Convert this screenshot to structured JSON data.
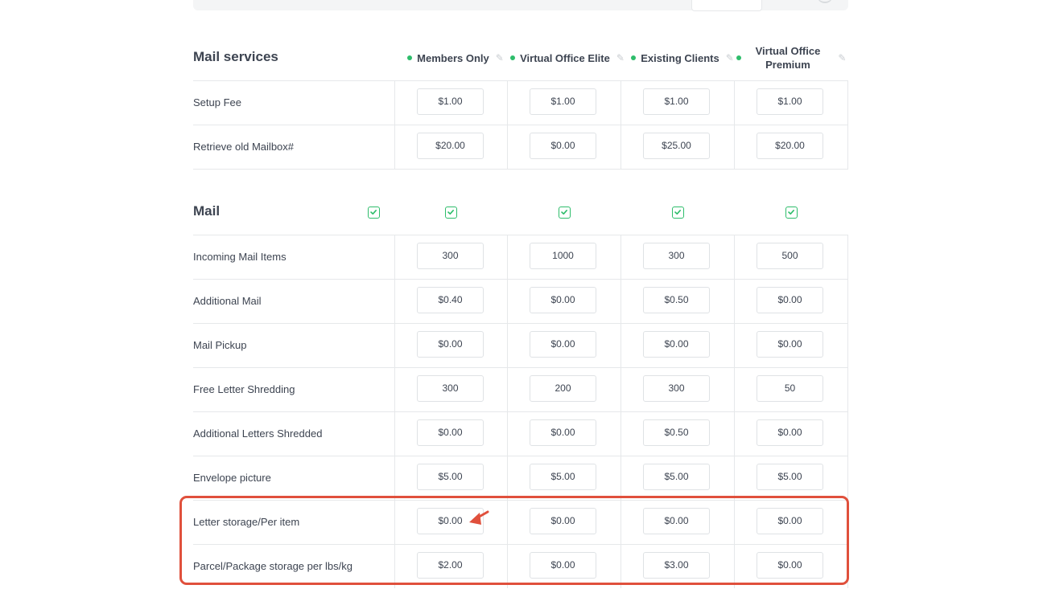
{
  "plans": [
    {
      "name": "Members Only"
    },
    {
      "name": "Virtual Office Elite"
    },
    {
      "name": "Existing Clients"
    },
    {
      "name": "Virtual Office Premium",
      "line1": "Virtual Office",
      "line2": "Premium"
    }
  ],
  "mail_services": {
    "title": "Mail services",
    "rows": [
      {
        "label": "Setup Fee",
        "values": [
          "$1.00",
          "$1.00",
          "$1.00",
          "$1.00"
        ]
      },
      {
        "label": "Retrieve old Mailbox#",
        "values": [
          "$20.00",
          "$0.00",
          "$25.00",
          "$20.00"
        ]
      }
    ]
  },
  "mail": {
    "title": "Mail",
    "rows": [
      {
        "label": "Incoming Mail Items",
        "values": [
          "300",
          "1000",
          "300",
          "500"
        ]
      },
      {
        "label": "Additional Mail",
        "values": [
          "$0.40",
          "$0.00",
          "$0.50",
          "$0.00"
        ]
      },
      {
        "label": "Mail Pickup",
        "values": [
          "$0.00",
          "$0.00",
          "$0.00",
          "$0.00"
        ]
      },
      {
        "label": "Free Letter Shredding",
        "values": [
          "300",
          "200",
          "300",
          "50"
        ]
      },
      {
        "label": "Additional Letters Shredded",
        "values": [
          "$0.00",
          "$0.00",
          "$0.50",
          "$0.00"
        ]
      },
      {
        "label": "Envelope picture",
        "values": [
          "$5.00",
          "$5.00",
          "$5.00",
          "$5.00"
        ]
      },
      {
        "label": "Letter storage/Per item",
        "values": [
          "$0.00",
          "$0.00",
          "$0.00",
          "$0.00"
        ]
      },
      {
        "label": "Parcel/Package storage per lbs/kg",
        "values": [
          "$2.00",
          "$0.00",
          "$3.00",
          "$0.00"
        ]
      }
    ]
  },
  "icons": {
    "status_dot": "green-dot-icon",
    "edit": "pencil-icon",
    "check": "checkbox-checked-icon",
    "annotation": "red-arrow-icon"
  },
  "colors": {
    "accent_green": "#2ebd6b",
    "highlight_red": "#e0503c",
    "border": "#e6e8ea",
    "text": "#3d4451"
  }
}
